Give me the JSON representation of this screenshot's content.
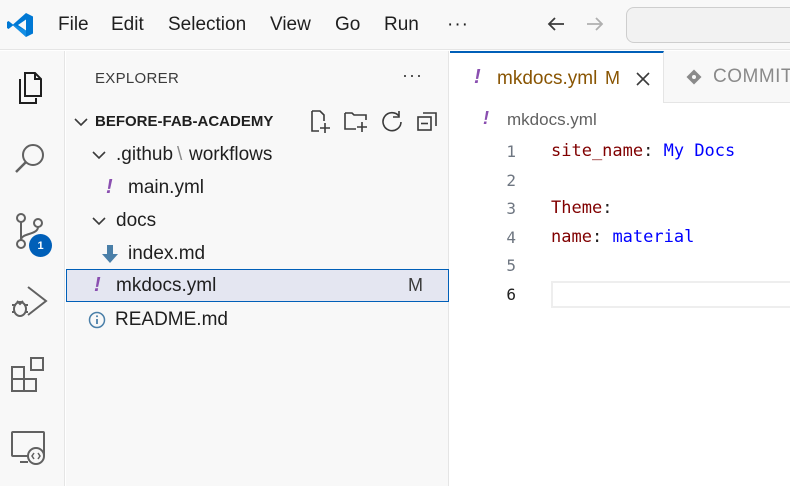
{
  "titlebar": {
    "menu": [
      "File",
      "Edit",
      "Selection",
      "View",
      "Go",
      "Run"
    ],
    "more": "···",
    "icons": [
      "vscode-logo",
      "back-arrow-icon",
      "forward-arrow-icon"
    ]
  },
  "activitybar": {
    "icons": [
      "explorer-icon",
      "search-icon",
      "source-control-icon",
      "run-debug-icon",
      "extensions-icon",
      "remote-explorer-icon"
    ],
    "scm_badge": "1"
  },
  "sidebar": {
    "title": "EXPLORER",
    "more": "···",
    "folder": "BEFORE-FAB-ACADEMY",
    "folder_actions": [
      "new-file-icon",
      "new-folder-icon",
      "refresh-icon",
      "collapse-all-icon"
    ],
    "tree": {
      "github_a": ".github",
      "github_sep": "\\",
      "github_b": "workflows",
      "main_yml": "main.yml",
      "docs": "docs",
      "index_md": "index.md",
      "mkdocs_yml": "mkdocs.yml",
      "mkdocs_status": "M",
      "readme": "README.md"
    },
    "yaml_glyph": "!"
  },
  "editor": {
    "tabs": [
      {
        "label": "mkdocs.yml",
        "status": "M",
        "active": true
      },
      {
        "label": "COMMIT",
        "active": false
      }
    ],
    "breadcrumb": "mkdocs.yml",
    "line_numbers": [
      "1",
      "2",
      "3",
      "4",
      "5",
      "6"
    ],
    "lines": {
      "l1_key": "site_name",
      "l1_colon": ": ",
      "l1_val": "My Docs",
      "l3_key": "Theme",
      "l3_colon": ":",
      "l4_key": "name",
      "l4_colon": ": ",
      "l4_val": "material"
    }
  },
  "colors": {
    "accent": "#005fb8",
    "modified": "#895503",
    "yaml_icon": "#8a4fb0",
    "yaml_key": "#800000",
    "yaml_value": "#0000ff"
  }
}
